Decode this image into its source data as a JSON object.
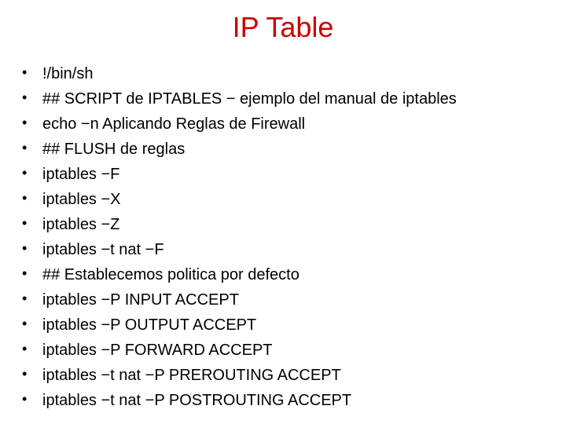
{
  "title": "IP Table",
  "items": [
    "!/bin/sh",
    "## SCRIPT de IPTABLES − ejemplo del manual de iptables",
    "echo −n Aplicando Reglas de Firewall",
    "## FLUSH de reglas",
    "iptables −F",
    "iptables −X",
    "iptables −Z",
    "iptables −t nat −F",
    "## Establecemos politica por defecto",
    "iptables −P INPUT ACCEPT",
    "iptables −P OUTPUT ACCEPT",
    "iptables −P FORWARD ACCEPT",
    "iptables −t nat −P PREROUTING ACCEPT",
    "iptables −t nat −P POSTROUTING ACCEPT"
  ]
}
